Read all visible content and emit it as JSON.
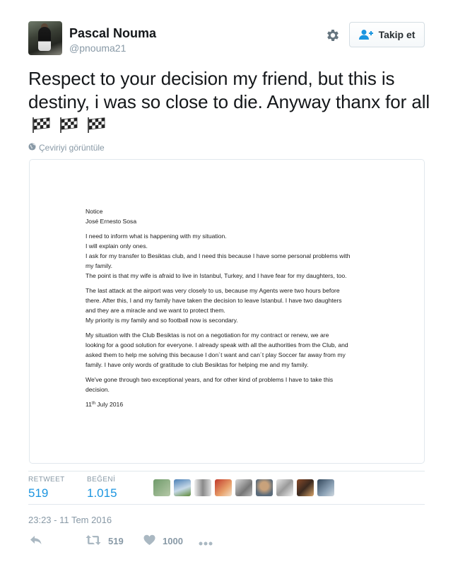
{
  "user": {
    "name": "Pascal Nouma",
    "handle": "@pnouma21"
  },
  "follow_button": {
    "label": "Takip et"
  },
  "tweet": {
    "text": "Respect to your decision my friend, but this is destiny, i was so close to die. Anyway thanx for all",
    "translate_label": "Çeviriyi görüntüle"
  },
  "letter": {
    "title": "Notice",
    "addressee": "José Ernesto Sosa",
    "p1": [
      "I need to inform what is happening with my situation.",
      "I will explain only ones.",
      "I ask for my transfer to Besiktas club, and I need this because I have some personal problems with",
      "my family.",
      "The point is that my wife is afraid to live in Istanbul, Turkey, and I have fear for my daughters, too."
    ],
    "p2": [
      "The last attack at the airport was very closely to us, because my Agents were two hours before",
      "there. After this, I and my family have taken the decision to leave Istanbul. I have two daughters",
      "and they are a miracle and we want to protect them.",
      "My priority is my family and so football now is secondary."
    ],
    "p3": [
      "My situation with the Club Besiktas is not on a negotiation for my contract or renew, we are",
      "looking for a good solution for everyone. I already speak with all the authorities from the Club, and",
      "asked them to help me solving this because I don´t want and can´t play Soccer far away from my",
      "family. I have only words of gratitude to club Besiktas for helping me and my family."
    ],
    "p4": [
      "We've gone through two exceptional years, and for other kind of problems I have to take this",
      "decision."
    ],
    "date_day": "11",
    "date_suffix": "th",
    "date_rest": "July 2016"
  },
  "stats": {
    "retweet_label": "RETWEET",
    "retweet_count": "519",
    "like_label": "BEĞENİ",
    "like_count": "1.015"
  },
  "timestamp": "23:23 - 11 Tem 2016",
  "actions": {
    "retweet_count": "519",
    "like_count": "1000"
  },
  "colors": {
    "link_blue": "#1b95e0",
    "muted_gray": "#8899a6",
    "border": "#e1e8ed"
  },
  "icons": [
    "gear-icon",
    "follow-person-icon",
    "globe-icon",
    "checkered-flag-icon",
    "reply-icon",
    "retweet-icon",
    "heart-icon",
    "more-icon"
  ]
}
